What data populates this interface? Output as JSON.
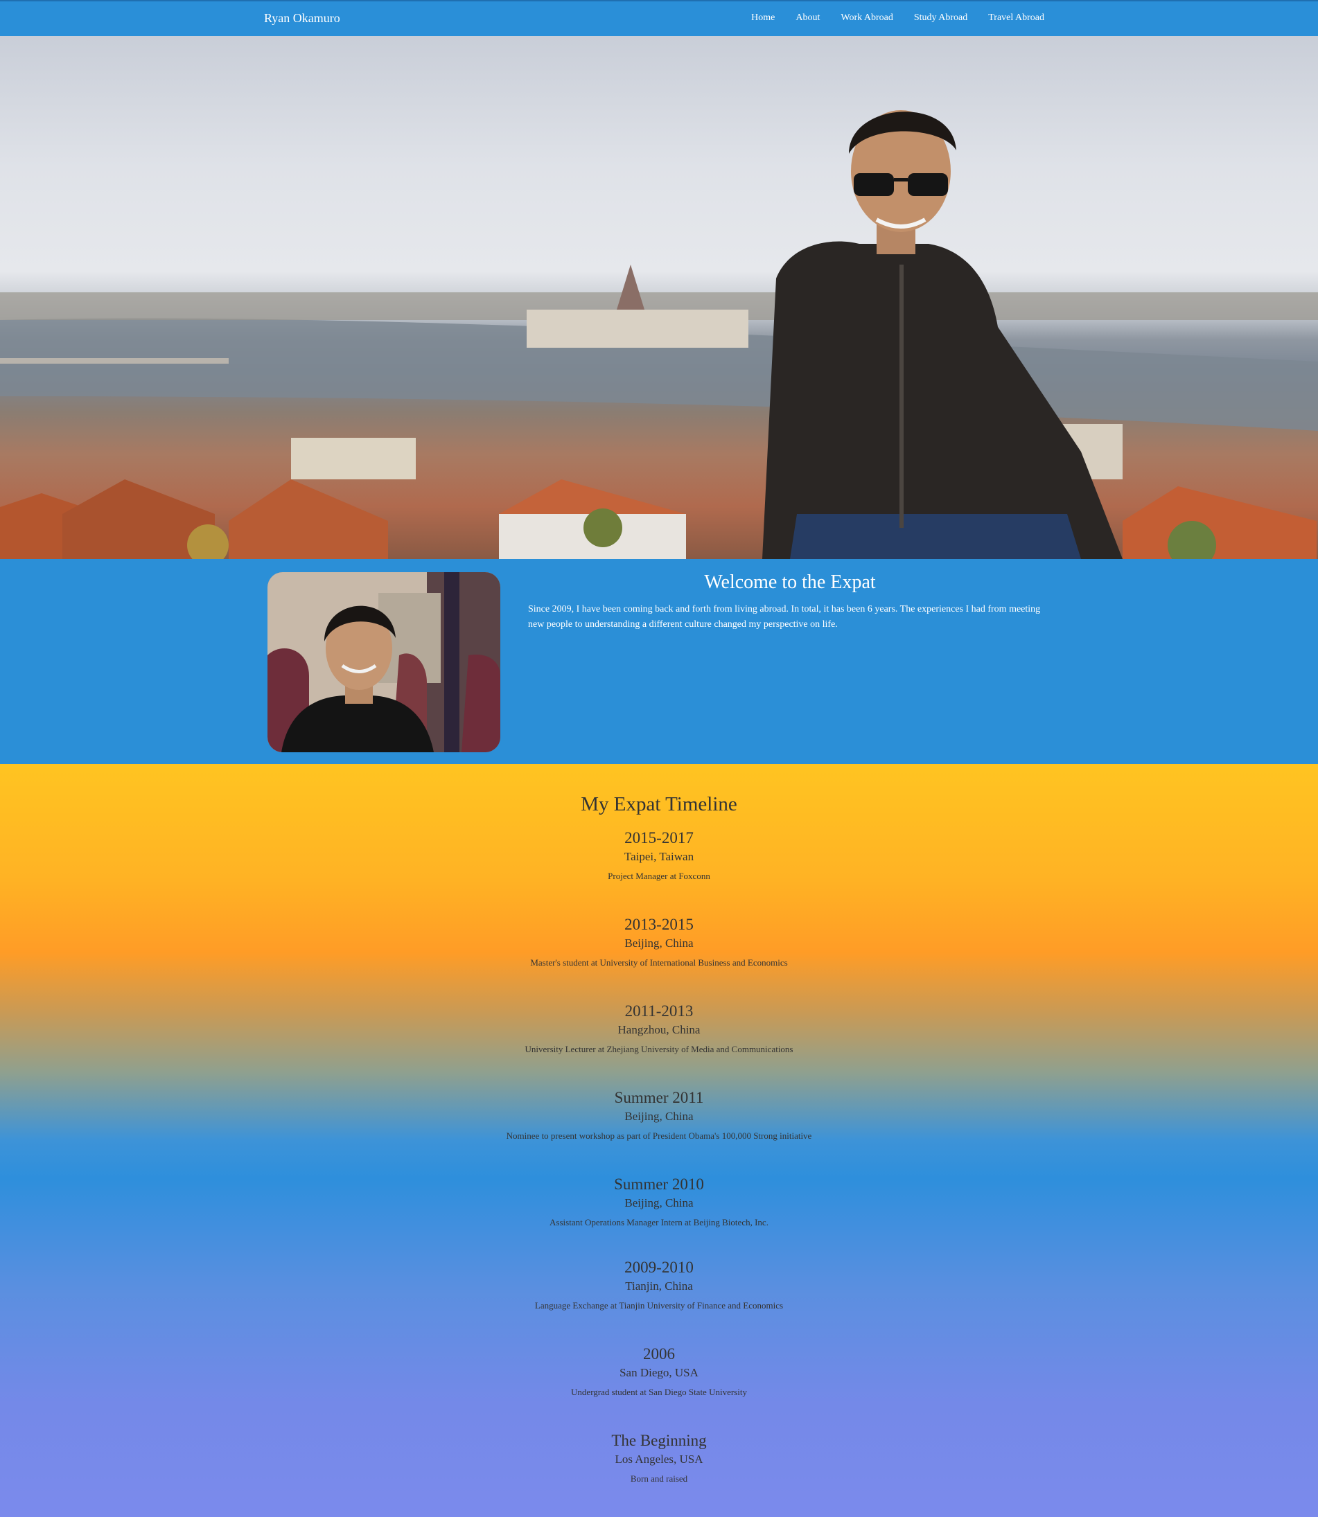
{
  "nav": {
    "brand": "Ryan Okamuro",
    "links": [
      "Home",
      "About",
      "Work Abroad",
      "Study Abroad",
      "Travel Abroad"
    ]
  },
  "welcome": {
    "title": "Welcome to the Expat",
    "text": "Since 2009, I have been coming back and forth from living abroad. In total, it has been 6 years. The experiences I had from meeting new people to understanding a different culture changed my perspective on life."
  },
  "timeline": {
    "title": "My Expat Timeline",
    "entries": [
      {
        "year": "2015-2017",
        "place": "Taipei, Taiwan",
        "desc": "Project Manager at Foxconn"
      },
      {
        "year": "2013-2015",
        "place": "Beijing, China",
        "desc": "Master's student at University of International Business and Economics"
      },
      {
        "year": "2011-2013",
        "place": "Hangzhou, China",
        "desc": "University Lecturer at Zhejiang University of Media and Communications"
      },
      {
        "year": "Summer 2011",
        "place": "Beijing, China",
        "desc": "Nominee to present workshop as part of President Obama's 100,000 Strong initiative"
      },
      {
        "year": "Summer 2010",
        "place": "Beijing, China",
        "desc": "Assistant Operations Manager Intern at Beijing Biotech, Inc."
      },
      {
        "year": "2009-2010",
        "place": "Tianjin, China",
        "desc": "Language Exchange at Tianjin University of Finance and Economics"
      },
      {
        "year": "2006",
        "place": "San Diego, USA",
        "desc": "Undergrad student at San Diego State University"
      },
      {
        "year": "The Beginning",
        "place": "Los Angeles, USA",
        "desc": "Born and raised"
      }
    ]
  }
}
